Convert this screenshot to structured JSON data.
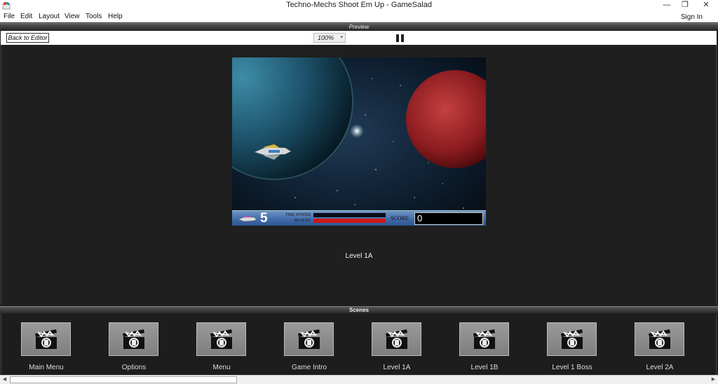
{
  "window": {
    "title": "Techno-Mechs Shoot Em Up - GameSalad",
    "minimize": "—",
    "restore": "❐",
    "close": "✕"
  },
  "menu": {
    "items": [
      "File",
      "Edit",
      "Layout",
      "View",
      "Tools",
      "Help"
    ],
    "sign_in": "Sign In"
  },
  "preview": {
    "header": "Preview",
    "back_label": "Back to Editor",
    "zoom": "100%",
    "scene_name": "Level 1A"
  },
  "hud": {
    "lives": "5",
    "fire_power_label": "FIRE POWER",
    "health_label": "HEALTH",
    "score_label": "SCORE",
    "score": "0",
    "fire_power_level": 0,
    "health_level": 1.0
  },
  "scenes": {
    "header": "Scenes",
    "items": [
      {
        "label": "Main Menu"
      },
      {
        "label": "Options"
      },
      {
        "label": "Menu"
      },
      {
        "label": "Game Intro"
      },
      {
        "label": "Level 1A"
      },
      {
        "label": "Level 1B"
      },
      {
        "label": "Level 1 Boss"
      },
      {
        "label": "Level 2A"
      }
    ]
  },
  "colors": {
    "health_bar": "#d01818",
    "fire_power_bar": "#1a4fd0",
    "hud_bg": "#4a72ad"
  }
}
